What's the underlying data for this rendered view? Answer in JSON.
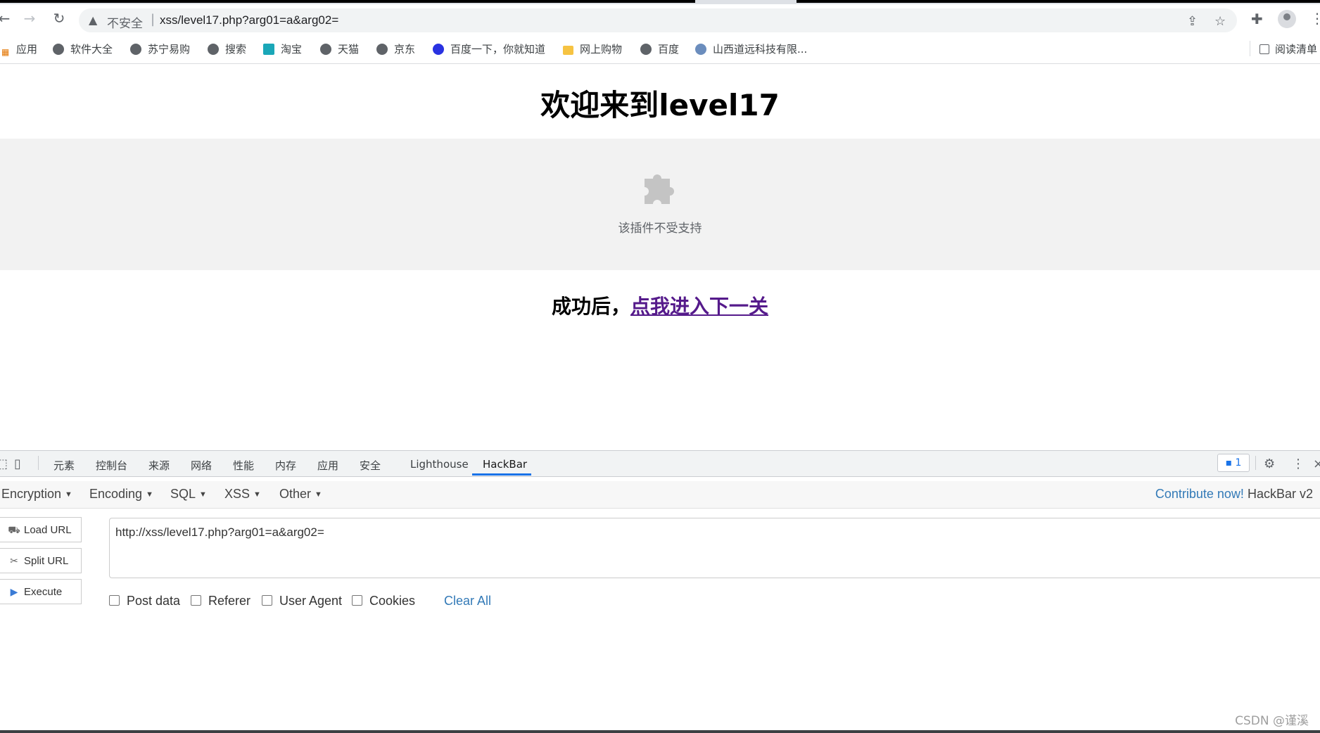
{
  "browser": {
    "insecure_label": "不安全",
    "url": "xss/level17.php?arg01=a&arg02="
  },
  "bookmarks": [
    {
      "label": "应用",
      "icon": "apps-grid-icon"
    },
    {
      "label": "软件大全",
      "icon": "globe-icon"
    },
    {
      "label": "苏宁易购",
      "icon": "globe-icon"
    },
    {
      "label": "搜索",
      "icon": "globe-icon"
    },
    {
      "label": "淘宝",
      "icon": "taobao-icon"
    },
    {
      "label": "天猫",
      "icon": "globe-icon"
    },
    {
      "label": "京东",
      "icon": "globe-icon"
    },
    {
      "label": "百度一下，你就知道",
      "icon": "baidu-icon"
    },
    {
      "label": "网上购物",
      "icon": "folder-icon"
    },
    {
      "label": "百度",
      "icon": "globe-icon"
    },
    {
      "label": "山西道远科技有限...",
      "icon": "site-icon"
    }
  ],
  "reading_list": "阅读清单",
  "page": {
    "title": "欢迎来到level17",
    "plugin_message": "该插件不受支持",
    "success_prefix": "成功后，",
    "next_link": "点我进入下一关"
  },
  "devtools": {
    "tabs": [
      "元素",
      "控制台",
      "来源",
      "网络",
      "性能",
      "内存",
      "应用",
      "安全",
      "Lighthouse",
      "HackBar"
    ],
    "active_tab": "HackBar",
    "issues_count": "1"
  },
  "hackbar": {
    "menus": [
      "Encryption",
      "Encoding",
      "SQL",
      "XSS",
      "Other"
    ],
    "contribute_link": "Contribute now!",
    "version": "HackBar v2",
    "buttons": {
      "load": "Load URL",
      "split": "Split URL",
      "execute": "Execute"
    },
    "url_value": "http://xss/level17.php?arg01=a&arg02=",
    "options": {
      "post": "Post data",
      "referer": "Referer",
      "user_agent": "User Agent",
      "cookies": "Cookies"
    },
    "clear_all": "Clear All"
  },
  "watermark": "CSDN @谨溪"
}
